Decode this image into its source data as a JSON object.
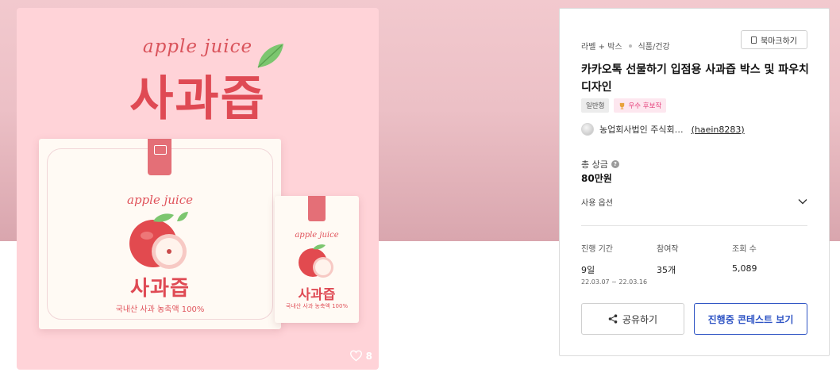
{
  "product_image": {
    "script_title": "apple juice",
    "main_title": "사과즙",
    "box": {
      "script": "apple juice",
      "title": "사과즙",
      "subtitle": "국내산 사과 농축액 100%"
    },
    "pouch": {
      "script": "apple juice",
      "title": "사과즙",
      "subtitle": "국내산 사과 농축액 100%"
    },
    "likes": "8"
  },
  "panel": {
    "breadcrumb": [
      "라벨 + 박스",
      "식품/건강"
    ],
    "bookmark_label": "북마크하기",
    "title": "카카오톡 선물하기 입점용 사과즙 박스 및 파우치 디자인",
    "badges": {
      "type": "일반형",
      "excellent": "우수 후보작"
    },
    "owner": {
      "name": "농업회사법인 주식회…",
      "id": "(haein8283)"
    },
    "prize": {
      "label": "총 상금",
      "value": "80만원"
    },
    "usage_label": "사용 옵션",
    "stats": {
      "period_label": "진행 기간",
      "period_value": "9일",
      "period_range": "22.03.07 ~ 22.03.16",
      "entries_label": "참여작",
      "entries_value": "35개",
      "views_label": "조회 수",
      "views_value": "5,089"
    },
    "share_label": "공유하기",
    "contest_label": "진행중 콘테스트 보기"
  },
  "icons": [
    "heart-icon",
    "bookmark-icon",
    "trophy-icon",
    "question-icon",
    "chevron-down-icon",
    "share-icon"
  ],
  "colors": {
    "accent_red": "#df4a54",
    "card_pink": "#ffd3d8",
    "primary_blue": "#2d53c4",
    "badge_pink": "#e6457e"
  }
}
